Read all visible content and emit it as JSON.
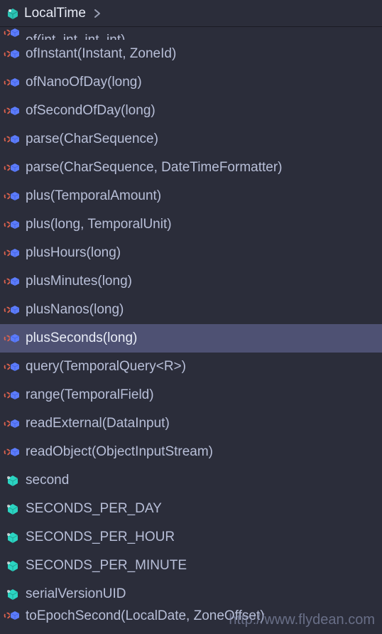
{
  "header": {
    "title": "LocalTime"
  },
  "items": [
    {
      "label": "of(int, int, int, int)",
      "kind": "method",
      "cut": "top"
    },
    {
      "label": "ofInstant(Instant, ZoneId)",
      "kind": "method"
    },
    {
      "label": "ofNanoOfDay(long)",
      "kind": "method"
    },
    {
      "label": "ofSecondOfDay(long)",
      "kind": "method"
    },
    {
      "label": "parse(CharSequence)",
      "kind": "method"
    },
    {
      "label": "parse(CharSequence, DateTimeFormatter)",
      "kind": "method"
    },
    {
      "label": "plus(TemporalAmount)",
      "kind": "method"
    },
    {
      "label": "plus(long, TemporalUnit)",
      "kind": "method"
    },
    {
      "label": "plusHours(long)",
      "kind": "method"
    },
    {
      "label": "plusMinutes(long)",
      "kind": "method"
    },
    {
      "label": "plusNanos(long)",
      "kind": "method"
    },
    {
      "label": "plusSeconds(long)",
      "kind": "method",
      "selected": true
    },
    {
      "label": "query(TemporalQuery<R>)",
      "kind": "method"
    },
    {
      "label": "range(TemporalField)",
      "kind": "method"
    },
    {
      "label": "readExternal(DataInput)",
      "kind": "method"
    },
    {
      "label": "readObject(ObjectInputStream)",
      "kind": "method"
    },
    {
      "label": "second",
      "kind": "field"
    },
    {
      "label": "SECONDS_PER_DAY",
      "kind": "field"
    },
    {
      "label": "SECONDS_PER_HOUR",
      "kind": "field"
    },
    {
      "label": "SECONDS_PER_MINUTE",
      "kind": "field"
    },
    {
      "label": "serialVersionUID",
      "kind": "field"
    },
    {
      "label": "toEpochSecond(LocalDate, ZoneOffset)",
      "kind": "method",
      "cut": "bottom"
    }
  ],
  "watermark": "http://www.flydean.com",
  "colors": {
    "bg": "#2b2d3a",
    "row_selected": "#4e5173",
    "text": "#b8bfd8",
    "text_selected": "#e8ecf6",
    "method_icon": "#5c7cfa",
    "field_icon": "#2bd4c2"
  }
}
